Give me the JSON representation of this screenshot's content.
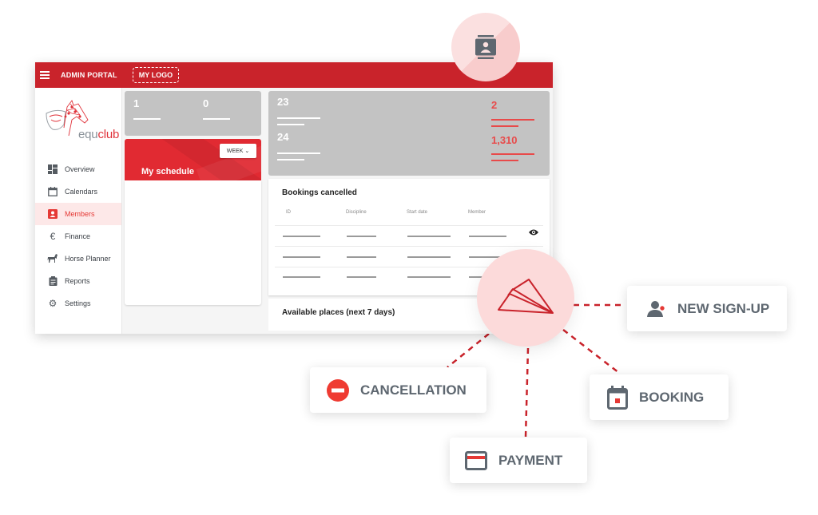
{
  "header": {
    "menu_icon": "hamburger-icon",
    "title": "ADMIN PORTAL",
    "logo_placeholder": "MY LOGO"
  },
  "brand": {
    "name_part1": "equ",
    "name_part2": "club",
    "accent": "#e0323a",
    "topbar_color": "#c9232b"
  },
  "sidebar": {
    "items": [
      {
        "label": "Overview",
        "icon": "dashboard-icon",
        "active": false
      },
      {
        "label": "Calendars",
        "icon": "calendar-icon",
        "active": false
      },
      {
        "label": "Members",
        "icon": "member-icon",
        "active": true
      },
      {
        "label": "Finance",
        "icon": "euro-icon",
        "active": false
      },
      {
        "label": "Horse Planner",
        "icon": "horse-icon",
        "active": false
      },
      {
        "label": "Reports",
        "icon": "clipboard-icon",
        "active": false
      },
      {
        "label": "Settings",
        "icon": "gear-icon",
        "active": false
      }
    ]
  },
  "stats_left": [
    "1",
    "0"
  ],
  "schedule": {
    "title": "My schedule",
    "period_select": "WEEK"
  },
  "stats_right": {
    "left": [
      "23",
      "24"
    ],
    "right": [
      "2",
      "1,310"
    ]
  },
  "bookings_cancelled": {
    "title": "Bookings cancelled",
    "columns": [
      "ID",
      "Discipline",
      "Start date",
      "Member"
    ],
    "row_count": 3
  },
  "available_places": {
    "title": "Available places (next 7 days)"
  },
  "notifications": {
    "hub_icon": "paper-plane-icon",
    "top_icon": "contact-card-icon",
    "events": [
      {
        "label": "NEW SIGN-UP",
        "icon": "user-add-icon"
      },
      {
        "label": "CANCELLATION",
        "icon": "minus-circle-icon"
      },
      {
        "label": "PAYMENT",
        "icon": "credit-card-icon"
      },
      {
        "label": "BOOKING",
        "icon": "calendar-event-icon"
      }
    ]
  }
}
